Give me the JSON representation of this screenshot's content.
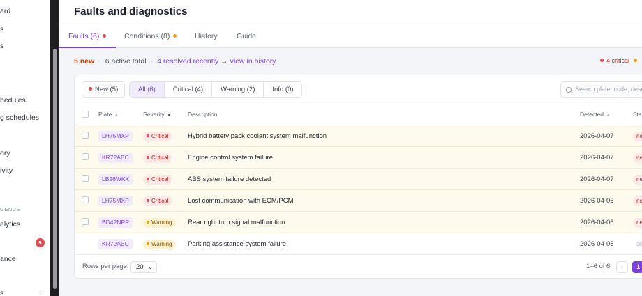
{
  "sidebar": {
    "items": [
      {
        "label": "ard"
      },
      {
        "label": "s"
      },
      {
        "label": "s"
      },
      {
        "label": "hedules"
      },
      {
        "label": "g schedules"
      },
      {
        "label": "ory"
      },
      {
        "label": "ivity"
      },
      {
        "label": "alytics"
      },
      {
        "label": "ance"
      },
      {
        "label": "s"
      }
    ],
    "section_heading": "GENCE",
    "faults_badge": "5"
  },
  "header": {
    "title": "Faults and diagnostics"
  },
  "tabs": [
    {
      "label": "Faults (6)",
      "dot_color": "#e5484d"
    },
    {
      "label": "Conditions (8)",
      "dot_color": "#f59e0b"
    },
    {
      "label": "History"
    },
    {
      "label": "Guide"
    }
  ],
  "summary": {
    "new": "5 new",
    "total": "6 active total",
    "resolved_link": "4 resolved recently → view in history",
    "critical": "4 critical"
  },
  "filters": {
    "new_chip": "New (5)",
    "segments": [
      "All (6)",
      "Critical (4)",
      "Warning (2)",
      "Info (0)"
    ],
    "search_placeholder": "Search plate, code, description"
  },
  "table": {
    "columns": {
      "plate": "Plate",
      "severity": "Severity",
      "description": "Description",
      "detected": "Detected",
      "status": "Status"
    },
    "rows": [
      {
        "plate": "LH75MXP",
        "severity": "Critical",
        "description": "Hybrid battery pack coolant system malfunction",
        "detected": "2026-04-07",
        "status": "new"
      },
      {
        "plate": "KR72ABC",
        "severity": "Critical",
        "description": "Engine control system failure",
        "detected": "2026-04-07",
        "status": "new"
      },
      {
        "plate": "LB26WKX",
        "severity": "Critical",
        "description": "ABS system failure detected",
        "detected": "2026-04-07",
        "status": "new"
      },
      {
        "plate": "LH75MXP",
        "severity": "Critical",
        "description": "Lost communication with ECM/PCM",
        "detected": "2026-04-06",
        "status": "new"
      },
      {
        "plate": "BD42NPR",
        "severity": "Warning",
        "description": "Rear right turn signal malfunction",
        "detected": "2026-04-06",
        "status": "new"
      },
      {
        "plate": "KR72ABC",
        "severity": "Warning",
        "description": "Parking assistance system failure",
        "detected": "2026-04-05",
        "status": "seen"
      }
    ]
  },
  "pagination": {
    "rows_per_page_label": "Rows per page:",
    "rows_per_page": "20",
    "range": "1–6 of 6",
    "prev": "‹",
    "current_page": "1"
  },
  "colors": {
    "accent": "#7b3fe4",
    "critical": "#e5484d",
    "warning": "#f59e0b",
    "new_highlight": "#fffaee"
  }
}
